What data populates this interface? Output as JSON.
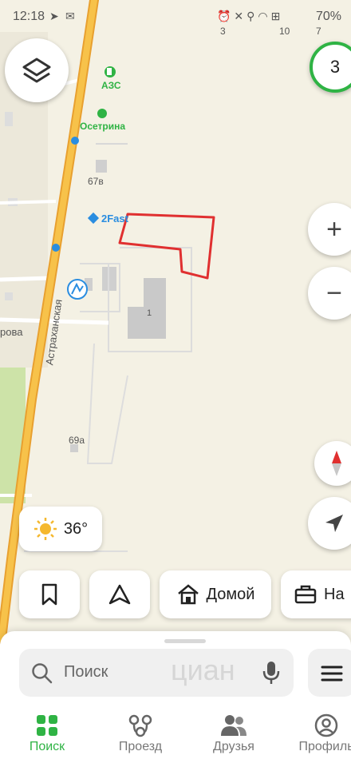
{
  "status": {
    "time": "12:18",
    "battery": "70%"
  },
  "map": {
    "labels": {
      "azs": "АЗС",
      "osetrina": "Осетрина",
      "fast": "2Fast",
      "street": "Астраханская",
      "street_left": "рова",
      "house_67v": "67в",
      "house_69a": "69а",
      "building_number": "1",
      "top_numbers": [
        "3",
        "10",
        "7"
      ]
    },
    "zoom_badge": "3",
    "weather": {
      "temp": "36°",
      "icon": "sun-icon"
    },
    "colors": {
      "road_main": "#f2a93b",
      "area_selection": "#e03030",
      "park": "#cde3a8",
      "accent_green": "#2fb344"
    }
  },
  "chips": {
    "home_label": "Домой",
    "work_label": "На"
  },
  "search": {
    "placeholder": "Поиск",
    "watermark": "циан"
  },
  "nav": {
    "items": [
      {
        "label": "Поиск",
        "icon": "grid-icon",
        "active": true
      },
      {
        "label": "Проезд",
        "icon": "route-icon",
        "active": false
      },
      {
        "label": "Друзья",
        "icon": "friends-icon",
        "active": false
      },
      {
        "label": "Профиль",
        "icon": "profile-icon",
        "active": false
      }
    ]
  }
}
